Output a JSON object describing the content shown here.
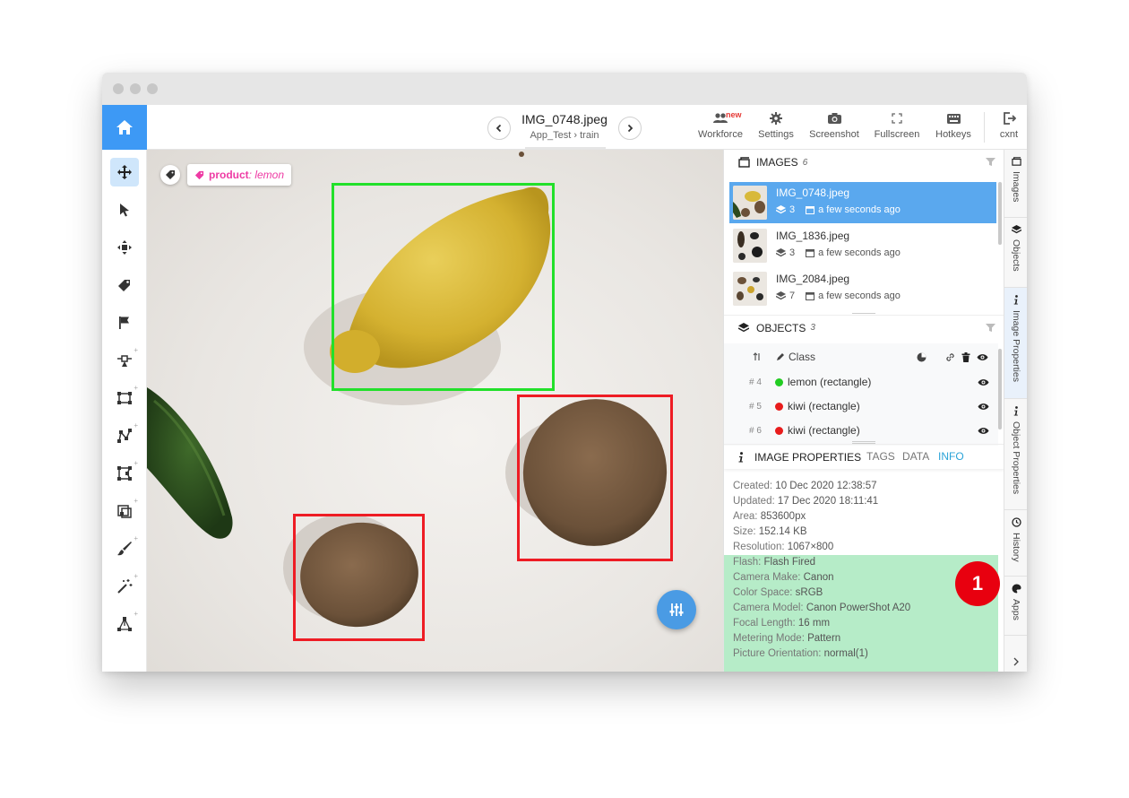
{
  "topbar": {
    "file_title": "IMG_0748.jpeg",
    "breadcrumb_project": "App_Test",
    "breadcrumb_sep": "›",
    "breadcrumb_dataset": "train",
    "new_badge": "new",
    "tools": [
      {
        "label": "Workforce",
        "icon": "users-icon"
      },
      {
        "label": "Settings",
        "icon": "gear-icon"
      },
      {
        "label": "Screenshot",
        "icon": "camera-icon"
      },
      {
        "label": "Fullscreen",
        "icon": "fullscreen-icon"
      },
      {
        "label": "Hotkeys",
        "icon": "keyboard-icon"
      },
      {
        "label": "cxnt",
        "icon": "logout-icon"
      }
    ]
  },
  "canvas": {
    "tag_class": "product",
    "tag_value": ": lemon",
    "tag_color": "#ee3ba4",
    "boxes": [
      {
        "label": "lemon",
        "color": "#22e02a"
      },
      {
        "label": "kiwi",
        "color": "#ee1c24"
      },
      {
        "label": "kiwi",
        "color": "#ee1c24"
      }
    ]
  },
  "images_panel": {
    "title": "IMAGES",
    "count": "6",
    "items": [
      {
        "name": "IMG_0748.jpeg",
        "objects": "3",
        "time": "a few seconds ago",
        "selected": true
      },
      {
        "name": "IMG_1836.jpeg",
        "objects": "3",
        "time": "a few seconds ago",
        "selected": false
      },
      {
        "name": "IMG_2084.jpeg",
        "objects": "7",
        "time": "a few seconds ago",
        "selected": false
      }
    ]
  },
  "objects_panel": {
    "title": "OBJECTS",
    "count": "3",
    "class_header": "Class",
    "items": [
      {
        "num": "# 4",
        "label": "lemon (rectangle)",
        "color": "#22cc22"
      },
      {
        "num": "# 5",
        "label": "kiwi (rectangle)",
        "color": "#e81c1c"
      },
      {
        "num": "# 6",
        "label": "kiwi (rectangle)",
        "color": "#e81c1c"
      }
    ]
  },
  "properties_panel": {
    "title": "IMAGE PROPERTIES",
    "tabs": [
      "TAGS",
      "DATA",
      "INFO"
    ],
    "active_tab": "INFO",
    "info": [
      {
        "key": "Created:",
        "value": " 10 Dec 2020 12:38:57"
      },
      {
        "key": "Updated:",
        "value": " 17 Dec 2020 18:11:41"
      },
      {
        "key": "Area:",
        "value": " 853600px"
      },
      {
        "key": "Size:",
        "value": " 152.14 KB"
      },
      {
        "key": "Resolution:",
        "value": " 1067×800"
      }
    ],
    "exif": [
      {
        "key": "Flash:",
        "value": " Flash Fired"
      },
      {
        "key": "Camera Make:",
        "value": " Canon"
      },
      {
        "key": "Color Space:",
        "value": " sRGB"
      },
      {
        "key": "Camera Model:",
        "value": " Canon PowerShot A20"
      },
      {
        "key": "Focal Length:",
        "value": " 16 mm"
      },
      {
        "key": "Metering Mode:",
        "value": " Pattern"
      },
      {
        "key": "Picture Orientation:",
        "value": " normal(1)"
      }
    ],
    "callout_number": "1"
  },
  "side_tabs": [
    "Images",
    "Objects",
    "Image Properties",
    "Object Properties",
    "History",
    "Apps"
  ],
  "colors": {
    "accent": "#3d99f5",
    "selected_row": "#5aa8ee",
    "exif_highlight": "#b6ecc8",
    "callout": "#e8000f",
    "info_tab_active": "#2aa3d8"
  }
}
